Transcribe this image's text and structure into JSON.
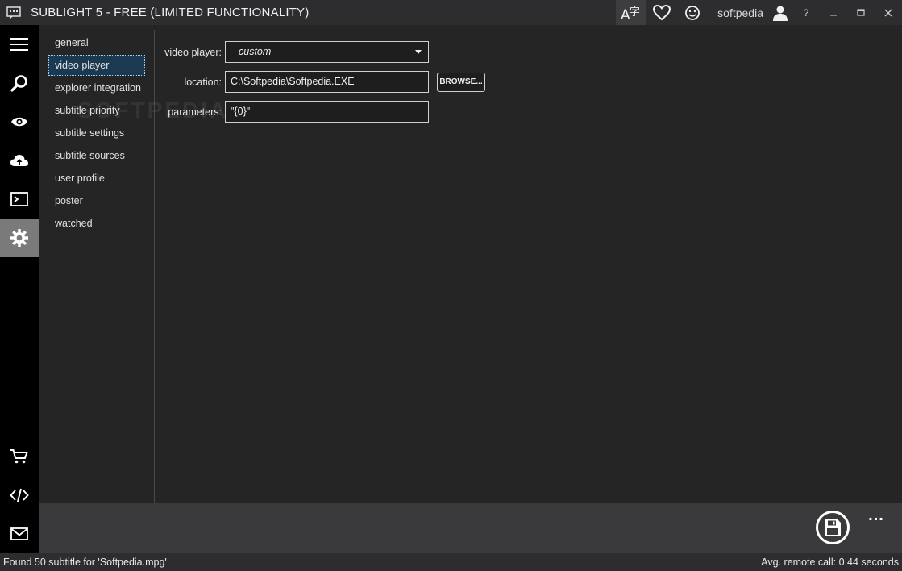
{
  "titlebar": {
    "title": "SUBLIGHT 5 - FREE (LIMITED FUNCTIONALITY)",
    "username": "softpedia",
    "help": "?"
  },
  "rail": {
    "items": [
      {
        "icon": "menu-icon"
      },
      {
        "icon": "search-icon"
      },
      {
        "icon": "eye-icon"
      },
      {
        "icon": "cloud-upload-icon"
      },
      {
        "icon": "terminal-icon"
      },
      {
        "icon": "gear-icon",
        "active": true
      },
      {
        "icon": "cart-icon"
      },
      {
        "icon": "code-icon"
      },
      {
        "icon": "mail-icon"
      }
    ]
  },
  "nav": {
    "items": [
      {
        "label": "general"
      },
      {
        "label": "video player",
        "selected": true
      },
      {
        "label": "explorer integration"
      },
      {
        "label": "subtitle priority"
      },
      {
        "label": "subtitle settings"
      },
      {
        "label": "subtitle sources"
      },
      {
        "label": "user profile"
      },
      {
        "label": "poster"
      },
      {
        "label": "watched"
      }
    ]
  },
  "form": {
    "video_player_label": "video player:",
    "video_player_value": "custom",
    "location_label": "location:",
    "location_value": "C:\\Softpedia\\Softpedia.EXE",
    "browse_label": "BROWSE...",
    "parameters_label": "parameters:",
    "parameters_value": "\"{0}\""
  },
  "watermark": "SOFTPEDIA",
  "actionbar": {
    "more_label": "..."
  },
  "status": {
    "left": "Found 50 subtitle for 'Softpedia.mpg'",
    "right": "Avg. remote call: 0.44 seconds"
  },
  "colors": {
    "background": "#252526",
    "rail": "#000000",
    "rail_active": "#7a7a7a",
    "selected_nav": "#1b3a52",
    "actionbar": "#3a3a3c"
  }
}
